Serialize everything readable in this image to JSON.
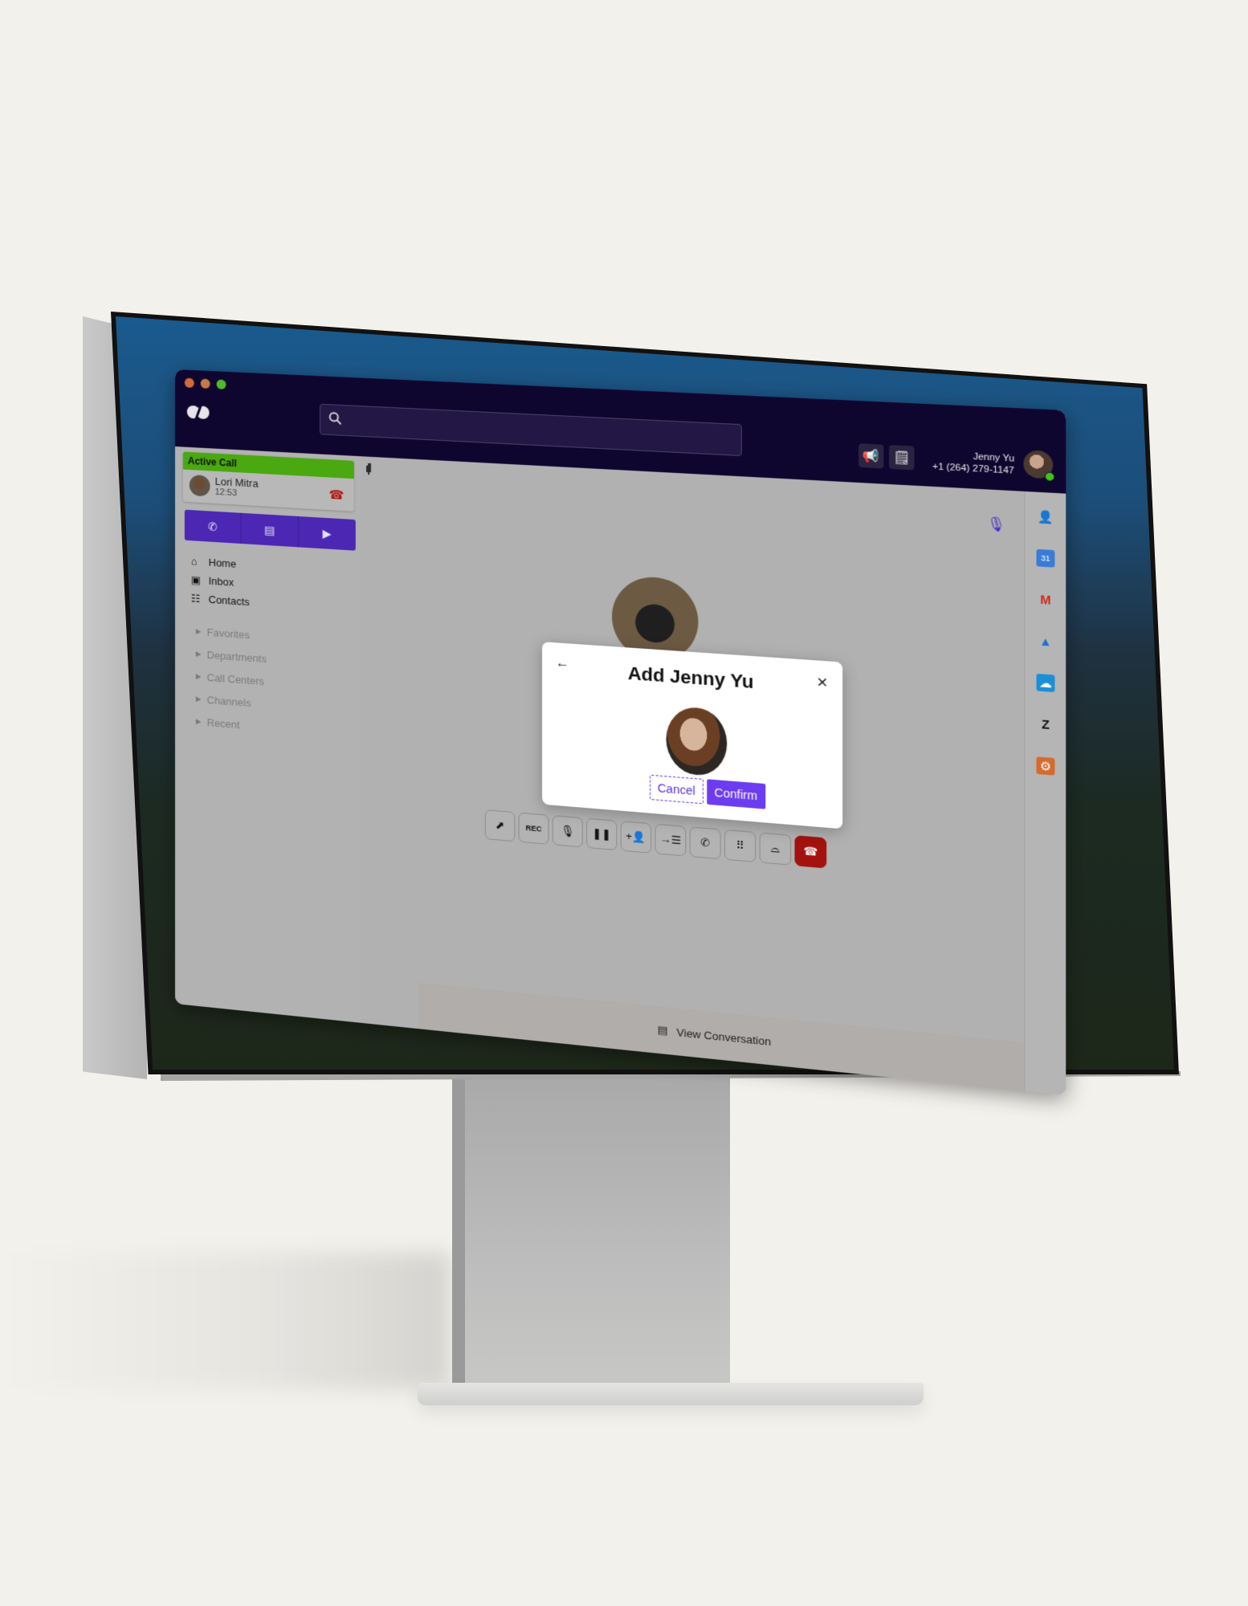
{
  "window": {
    "traffic_lights": [
      "#d36a3a",
      "#c57a48",
      "#4dbb2a"
    ],
    "logo_icon": "dialpad-logo"
  },
  "search": {
    "placeholder": "",
    "value": "",
    "icon": "search-icon"
  },
  "toolbar": {
    "announce_icon": "megaphone-icon",
    "notes_icon": "notepad-icon"
  },
  "user": {
    "name": "Jenny Yu",
    "phone": "+1 (264) 279-1147",
    "status_color": "#3fc41c"
  },
  "active_call": {
    "header": "Active Call",
    "caller_name": "Lori Mitra",
    "duration": "12:53",
    "header_color": "#4aa810"
  },
  "quick_actions": [
    {
      "name": "call",
      "icon": "phone-icon"
    },
    {
      "name": "message",
      "icon": "chat-icon"
    },
    {
      "name": "video",
      "icon": "video-icon"
    }
  ],
  "nav": [
    {
      "label": "Home",
      "icon": "home-icon"
    },
    {
      "label": "Inbox",
      "icon": "inbox-icon"
    },
    {
      "label": "Contacts",
      "icon": "contacts-icon"
    }
  ],
  "groups": [
    {
      "label": "Favorites"
    },
    {
      "label": "Departments"
    },
    {
      "label": "Call Centers"
    },
    {
      "label": "Channels"
    },
    {
      "label": "Recent"
    }
  ],
  "call": {
    "timer": "12:53",
    "controls": [
      {
        "name": "share-screen",
        "icon": "screen-share-icon",
        "glyph": "⬈"
      },
      {
        "name": "record",
        "icon": "rec-icon",
        "glyph": "REC"
      },
      {
        "name": "mute",
        "icon": "microphone-icon",
        "glyph": "🎙"
      },
      {
        "name": "hold",
        "icon": "pause-icon",
        "glyph": "❚❚"
      },
      {
        "name": "add-person",
        "icon": "add-person-icon",
        "glyph": "+👤"
      },
      {
        "name": "transfer",
        "icon": "transfer-icon",
        "glyph": "→☰"
      },
      {
        "name": "swap-call",
        "icon": "call-swap-icon",
        "glyph": "✆"
      },
      {
        "name": "keypad",
        "icon": "keypad-icon",
        "glyph": "⠿"
      },
      {
        "name": "voicemail-drop",
        "icon": "voicemail-icon",
        "glyph": "⌓"
      },
      {
        "name": "hang-up",
        "icon": "hang-up-icon",
        "glyph": "☎"
      }
    ],
    "end_color": "#a3120f"
  },
  "conversation": {
    "label": "View Conversation",
    "icon": "chat-icon"
  },
  "rail": [
    {
      "name": "contact",
      "icon": "person-icon",
      "color": "#111111"
    },
    {
      "name": "google-calendar",
      "icon": "calendar-icon",
      "color": "#3a7bd5",
      "text": "31"
    },
    {
      "name": "gmail",
      "icon": "gmail-icon",
      "color": "#d0291e",
      "text": "M"
    },
    {
      "name": "google-drive",
      "icon": "drive-icon",
      "color": "#1f6fd0",
      "text": "▲"
    },
    {
      "name": "salesforce",
      "icon": "salesforce-icon",
      "color": "#1a8fd6",
      "text": "☁"
    },
    {
      "name": "zendesk",
      "icon": "zendesk-icon",
      "color": "#111111",
      "text": "Z"
    },
    {
      "name": "hubspot",
      "icon": "hubspot-icon",
      "color": "#d46a2c",
      "text": "⚙"
    }
  ],
  "modal": {
    "title": "Add Jenny Yu",
    "cancel_label": "Cancel",
    "confirm_label": "Confirm",
    "accent": "#6c3cf0"
  }
}
